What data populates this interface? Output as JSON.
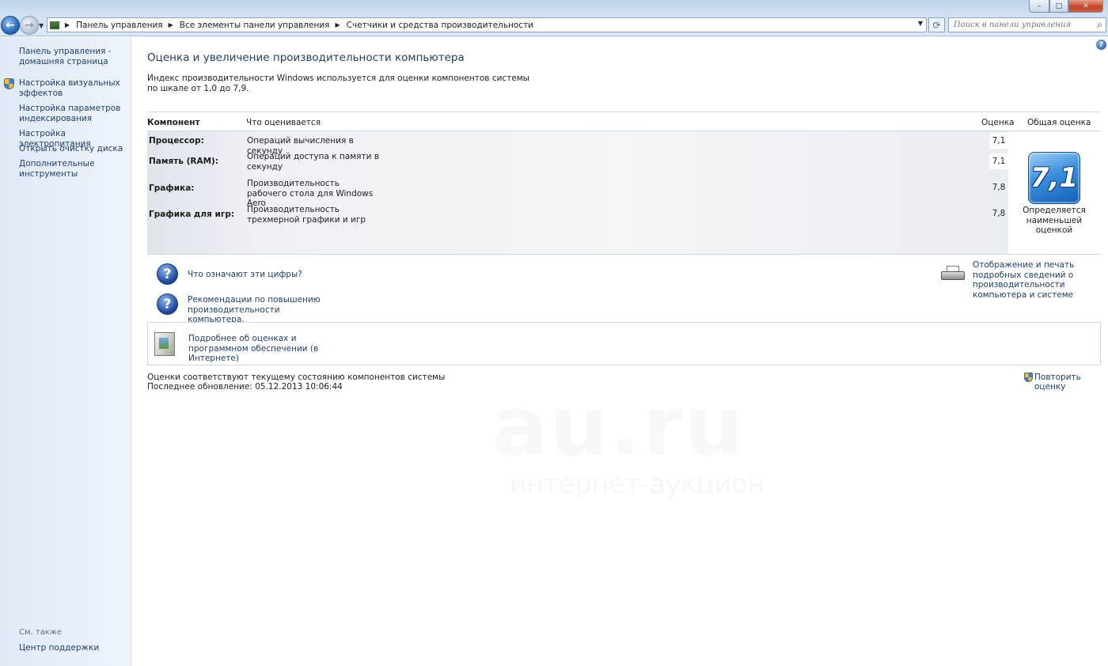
{
  "window": {
    "minimize": "–",
    "maximize": "□",
    "close": "✕"
  },
  "nav": {
    "back": "←",
    "forward": "→",
    "history_dropdown": "▼"
  },
  "breadcrumb": [
    "Панель управления",
    "Все элементы панели управления",
    "Счетчики и средства производительности"
  ],
  "search": {
    "placeholder": "Поиск в панели управления"
  },
  "sidebar": {
    "items": [
      {
        "label": "Панель управления - домашняя страница"
      },
      {
        "label": "Настройка визуальных эффектов"
      },
      {
        "label": "Настройка параметров индексирования"
      },
      {
        "label": "Настройка электропитания"
      },
      {
        "label": "Открыть очистку диска"
      },
      {
        "label": "Дополнительные инструменты"
      }
    ],
    "see_also": "См. также",
    "support_center": "Центр поддержки"
  },
  "main": {
    "title": "Оценка и увеличение производительности компьютера",
    "intro": "Индекс производительности Windows используется для оценки компонентов системы по шкале от 1,0 до 7,9.",
    "columns": {
      "component": "Компонент",
      "what": "Что оценивается",
      "score": "Оценка",
      "base": "Общая оценка"
    },
    "rows": [
      {
        "component": "Процессор:",
        "what": "Операций вычисления в секунду",
        "score": "7,1"
      },
      {
        "component": "Память (RAM):",
        "what": "Операций доступа к памяти в секунду",
        "score": "7,1"
      },
      {
        "component": "Графика:",
        "what": "Производительность рабочего стола для Windows Aero",
        "score": "7,8"
      },
      {
        "component": "Графика для игр:",
        "what": "Производительность трехмерной графики и игр",
        "score": "7,8"
      }
    ],
    "base_score": "7,1",
    "base_caption": "Определяется наименьшей оценкой",
    "links": {
      "what_numbers": "Что означают эти цифры?",
      "tips": "Рекомендации по повышению производительности компьютера.",
      "print_details": "Отображение и печать подробных сведений о производительности компьютера и системе",
      "learn_more": "Подробнее об оценках и программном обеспечении (в Интернете)"
    },
    "status_line": "Оценки соответствуют текущему состоянию компонентов системы",
    "last_update": "Последнее обновление: 05.12.2013 10:06:44",
    "rerun": "Повторить оценку"
  },
  "watermark": {
    "logo": "au.ru",
    "tagline": "интернет-аукцион"
  }
}
